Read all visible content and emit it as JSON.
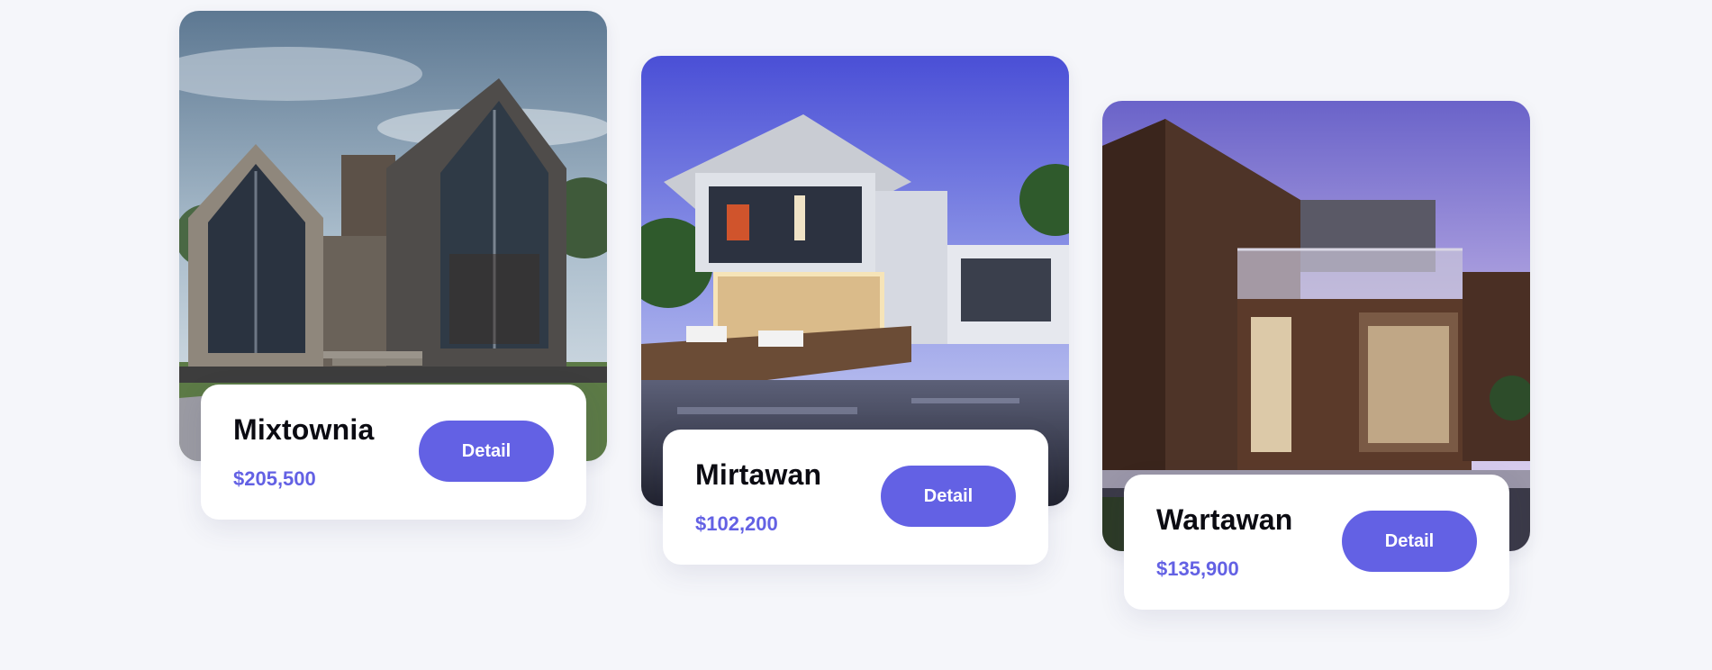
{
  "properties": [
    {
      "name": "Mixtownia",
      "price": "$205,500",
      "button_label": "Detail",
      "image": "a-frame-house-photo"
    },
    {
      "name": "Mirtawan",
      "price": "$102,200",
      "button_label": "Detail",
      "image": "modern-pool-house-photo"
    },
    {
      "name": "Wartawan",
      "price": "$135,900",
      "button_label": "Detail",
      "image": "wooden-villa-photo"
    }
  ],
  "colors": {
    "background": "#f5f6fa",
    "accent": "#6361e4",
    "card": "#ffffff",
    "title": "#0b0b12"
  }
}
